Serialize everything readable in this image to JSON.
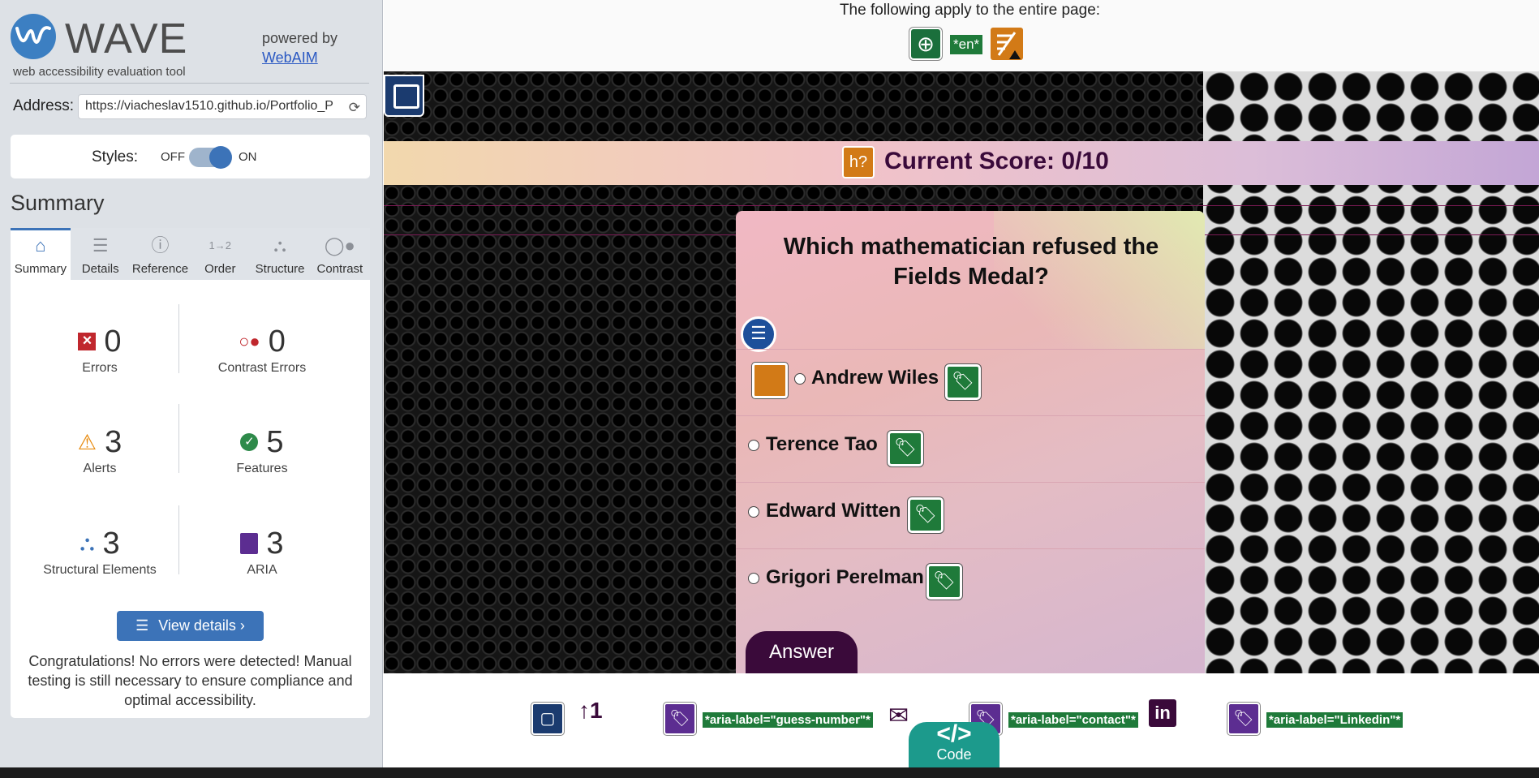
{
  "sidebar": {
    "logo": "WAVE",
    "tagline": "web accessibility evaluation tool",
    "powered_by": "powered by",
    "powered_link": "WebAIM",
    "address_label": "Address:",
    "address_value": "https://viacheslav1510.github.io/Portfolio_P",
    "styles_label": "Styles:",
    "styles_off": "OFF",
    "styles_on": "ON",
    "summary_title": "Summary",
    "tabs": [
      {
        "label": "Summary",
        "icon": "home-icon"
      },
      {
        "label": "Details",
        "icon": "list-icon"
      },
      {
        "label": "Reference",
        "icon": "info-icon"
      },
      {
        "label": "Order",
        "icon": "order-icon"
      },
      {
        "label": "Structure",
        "icon": "structure-icon"
      },
      {
        "label": "Contrast",
        "icon": "contrast-icon"
      }
    ],
    "stats": {
      "errors": {
        "count": "0",
        "label": "Errors"
      },
      "contrast": {
        "count": "0",
        "label": "Contrast Errors"
      },
      "alerts": {
        "count": "3",
        "label": "Alerts"
      },
      "features": {
        "count": "5",
        "label": "Features"
      },
      "structural": {
        "count": "3",
        "label": "Structural Elements"
      },
      "aria": {
        "count": "3",
        "label": "ARIA"
      }
    },
    "view_details": "View details ›",
    "congrats": "Congratulations! No errors were detected! Manual testing is still necessary to ensure compliance and optimal accessibility."
  },
  "topbar": {
    "note": "The following apply to the entire page:",
    "lang_badge": "*en*"
  },
  "quiz": {
    "score": "Current Score: 0/10",
    "h_icon": "h?",
    "question": "Which mathematician refused the Fields Medal?",
    "options": [
      "Andrew Wiles",
      "Terence Tao",
      "Edward Witten",
      "Grigori Perelman"
    ],
    "answer_button": "Answer"
  },
  "footer": {
    "aria_labels": [
      "*aria-label=\"guess-number\"*",
      "*aria-label=\"contact\"*",
      "*aria-label=\"Linkedin\"*"
    ],
    "code_symbol": "</>",
    "code_label": "Code",
    "linkedin_text": "in"
  },
  "colors": {
    "accent": "#3c73b8",
    "error": "#c0272d",
    "feature": "#1f7a3a",
    "alert": "#d27a17",
    "aria": "#5c2d91",
    "score_text": "#3a0a3a"
  }
}
